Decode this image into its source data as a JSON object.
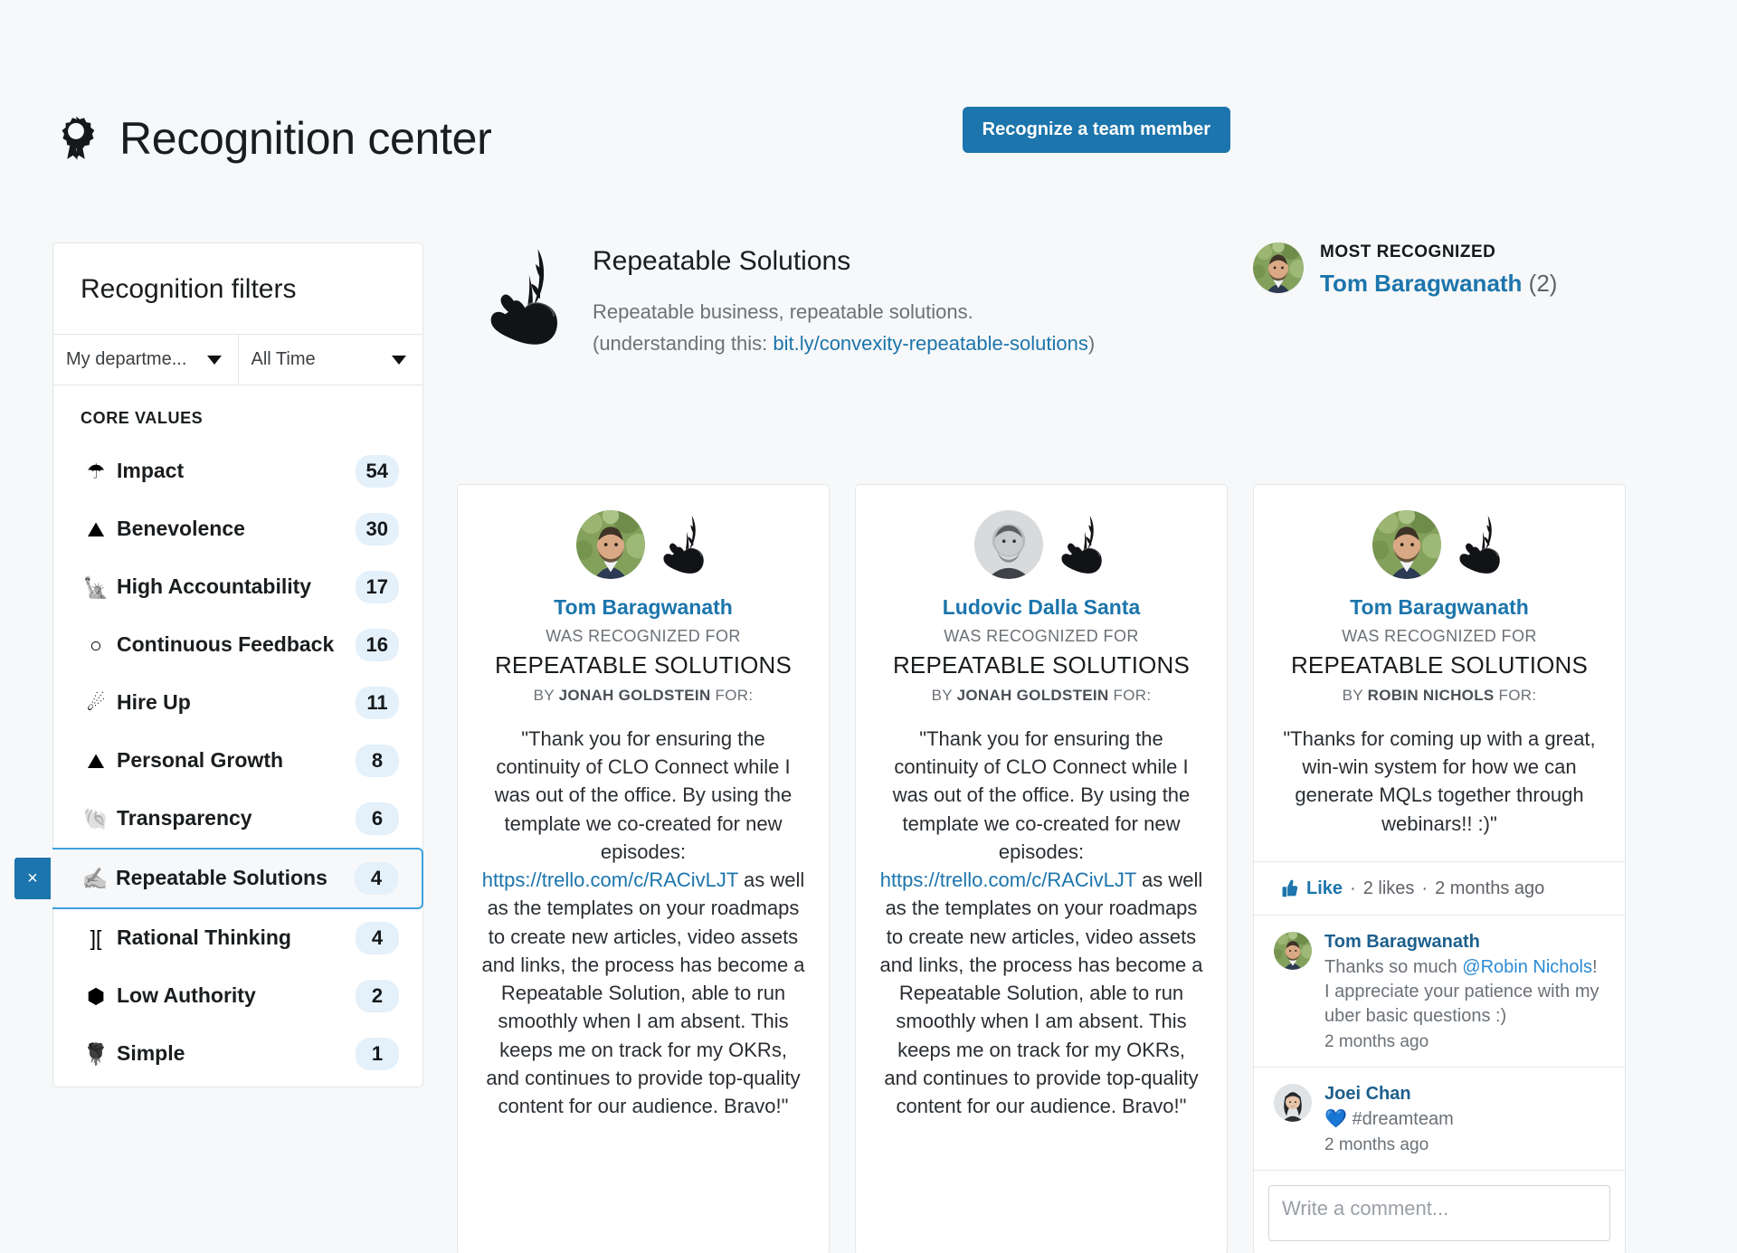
{
  "header": {
    "title": "Recognition center",
    "icon": "rosette-award-icon",
    "recognize_button": "Recognize a team member",
    "accent_color": "#1c75ac"
  },
  "sidebar": {
    "title": "Recognition filters",
    "department_select": "My departme...",
    "time_select": "All Time",
    "section_label": "CORE VALUES",
    "clear_filter_label": "×",
    "items": [
      {
        "icon": "umbrella-icon",
        "glyph": "☂",
        "label": "Impact",
        "count": "54",
        "selected": false
      },
      {
        "icon": "mountain-icon",
        "glyph": "⛰",
        "label": "Benevolence",
        "count": "30",
        "selected": false
      },
      {
        "icon": "statue-of-liberty-icon",
        "glyph": "🗽",
        "label": "High Accountability",
        "count": "17",
        "selected": false
      },
      {
        "icon": "circle-icon",
        "glyph": "○",
        "label": "Continuous Feedback",
        "count": "16",
        "selected": false
      },
      {
        "icon": "comet-icon",
        "glyph": "☄",
        "label": "Hire Up",
        "count": "11",
        "selected": false
      },
      {
        "icon": "pyramid-icon",
        "glyph": "⛰",
        "label": "Personal Growth",
        "count": "8",
        "selected": false
      },
      {
        "icon": "shell-icon",
        "glyph": "🐚",
        "label": "Transparency",
        "count": "6",
        "selected": false
      },
      {
        "icon": "hand-with-quill-icon",
        "glyph": "✍",
        "label": "Repeatable Solutions",
        "count": "4",
        "selected": true
      },
      {
        "icon": "brackets-icon",
        "glyph": "][",
        "label": "Rational Thinking",
        "count": "4",
        "selected": false
      },
      {
        "icon": "shield-icon",
        "glyph": "⬢",
        "label": "Low Authority",
        "count": "2",
        "selected": false
      },
      {
        "icon": "rose-icon",
        "glyph": "🌹",
        "label": "Simple",
        "count": "1",
        "selected": false
      }
    ]
  },
  "value_hero": {
    "badge_icon": "hand-holding-quill-badge",
    "name": "Repeatable Solutions",
    "description_line1": "Repeatable business, repeatable solutions.",
    "description_prefix": "(understanding this: ",
    "link_text": "bit.ly/convexity-repeatable-solutions",
    "description_suffix": ")"
  },
  "most_recognized": {
    "label": "MOST RECOGNIZED",
    "name": "Tom Baragwanath",
    "count": "(2)",
    "avatar": "tom-avatar"
  },
  "cards": [
    {
      "recipient": "Tom Baragwanath",
      "was_recognized_for": "WAS RECOGNIZED FOR",
      "value_name": "REPEATABLE SOLUTIONS",
      "by_prefix": "BY",
      "by_name": "JONAH GOLDSTEIN",
      "by_suffix": "FOR:",
      "quote_part1": "\"Thank you for ensuring the continuity of CLO Connect while I was out of the office. By using the template we co-created for new episodes: ",
      "quote_link": "https://trello.com/c/RACivLJT",
      "quote_part2": " as well as the templates on your roadmaps to create new articles, video assets and links, the process has become a Repeatable Solution, able to run smoothly when I am absent. This keeps me on track for my OKRs, and continues to provide top-quality content for our audience. Bravo!\"",
      "avatar": "tom-avatar"
    },
    {
      "recipient": "Ludovic Dalla Santa",
      "was_recognized_for": "WAS RECOGNIZED FOR",
      "value_name": "REPEATABLE SOLUTIONS",
      "by_prefix": "BY",
      "by_name": "JONAH GOLDSTEIN",
      "by_suffix": "FOR:",
      "quote_part1": "\"Thank you for ensuring the continuity of CLO Connect while I was out of the office. By using the template we co-created for new episodes: ",
      "quote_link": "https://trello.com/c/RACivLJT",
      "quote_part2": " as well as the templates on your roadmaps to create new articles, video assets and links, the process has become a Repeatable Solution, able to run smoothly when I am absent. This keeps me on track for my OKRs, and continues to provide top-quality content for our audience. Bravo!\"",
      "avatar": "ludovic-avatar"
    },
    {
      "recipient": "Tom Baragwanath",
      "was_recognized_for": "WAS RECOGNIZED FOR",
      "value_name": "REPEATABLE SOLUTIONS",
      "by_prefix": "BY",
      "by_name": "ROBIN NICHOLS",
      "by_suffix": "FOR:",
      "quote_part1": "\"Thanks for coming up with a great, win-win system for how we can generate MQLs together through webinars!! :)\"",
      "avatar": "tom-avatar",
      "like_label": "Like",
      "like_sep1": "·",
      "likes_count": "2 likes",
      "like_sep2": "·",
      "posted_time": "2 months ago",
      "comments": [
        {
          "name": "Tom Baragwanath",
          "text_part1": "Thanks so much ",
          "mention": "@Robin Nichols",
          "text_part2": "! I appreciate your patience with my uber basic questions :)",
          "time": "2 months ago",
          "avatar": "tom-avatar"
        },
        {
          "name": "Joei Chan",
          "text_part1": "💙 #dreamteam",
          "mention": "",
          "text_part2": "",
          "time": "2 months ago",
          "avatar": "joei-avatar"
        }
      ],
      "comment_placeholder": "Write a comment..."
    }
  ]
}
